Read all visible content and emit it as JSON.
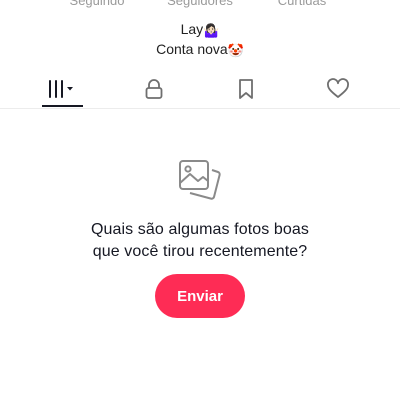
{
  "profile": {
    "stats": {
      "following_label": "Seguindo",
      "followers_label": "Seguidores",
      "likes_label": "Curtidas"
    },
    "bio": {
      "line1": "Lay",
      "line1_emoji": "🤷🏻‍♀️",
      "line2": "Conta nova",
      "line2_emoji": "🤡"
    }
  },
  "tabs": [
    {
      "id": "videos",
      "icon": "grid-bars-icon",
      "selected": true
    },
    {
      "id": "private",
      "icon": "lock-icon",
      "selected": false
    },
    {
      "id": "saved",
      "icon": "bookmark-icon",
      "selected": false
    },
    {
      "id": "liked",
      "icon": "heart-icon",
      "selected": false
    }
  ],
  "empty_state": {
    "icon": "photos-icon",
    "line1": "Quais são algumas fotos boas",
    "line2": "que você tirou recentemente?",
    "button_label": "Enviar"
  },
  "colors": {
    "accent": "#fe2c55",
    "text_primary": "#161823",
    "text_muted": "#9a9a9a"
  }
}
